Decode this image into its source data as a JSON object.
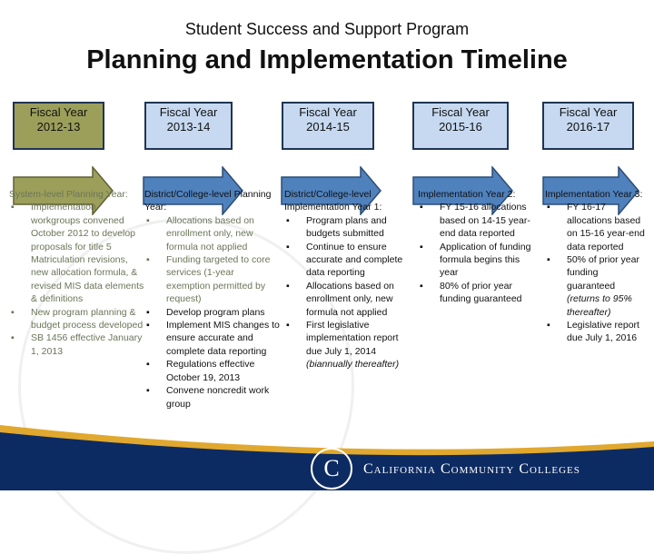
{
  "header": {
    "subtitle": "Student Success and Support Program",
    "title": "Planning and Implementation Timeline"
  },
  "colors": {
    "current_year": "#9c9f5a",
    "future_year": "#c6d9f1",
    "arrow_blue": "#4f81bd",
    "navy": "#0d2b63",
    "gold": "#e0a82e"
  },
  "years": [
    {
      "label": "Fiscal Year",
      "year": "2012-13"
    },
    {
      "label": "Fiscal Year",
      "year": "2013-14"
    },
    {
      "label": "Fiscal Year",
      "year": "2014-15"
    },
    {
      "label": "Fiscal Year",
      "year": "2015-16"
    },
    {
      "label": "Fiscal Year",
      "year": "2016-17"
    }
  ],
  "columns": [
    {
      "heading": "System-level Planning Year:",
      "items": [
        "Implementation workgroups convened October 2012 to develop proposals for title 5 Matriculation revisions, new allocation formula, & revised MIS data elements & definitions",
        "New program planning & budget process developed",
        "SB 1456 effective January 1, 2013"
      ]
    },
    {
      "heading": "District/College-level Planning Year:",
      "items": [
        "Allocations based on enrollment only, new formula not applied",
        "Funding targeted to core services (1-year exemption permitted by request)",
        "Develop program plans",
        "Implement MIS changes to ensure accurate and complete data reporting",
        "Regulations effective October 19, 2013",
        "Convene noncredit work group"
      ]
    },
    {
      "heading": "District/College-level Implementation Year 1:",
      "items": [
        "Program plans and budgets submitted",
        "Continue to ensure accurate and complete data reporting",
        "Allocations based on enrollment only, new formula not applied",
        "First legislative implementation report due July 1, 2014"
      ],
      "note": "(biannually thereafter)"
    },
    {
      "heading": "Implementation Year 2:",
      "items": [
        "FY 15-16 allocations based on 14-15 year-end data reported",
        "Application of funding formula begins this year",
        "80% of prior year funding guaranteed"
      ]
    },
    {
      "heading": "Implementation Year 3:",
      "items": [
        "FY 16-17 allocations based on 15-16 year-end data reported",
        "50% of prior year funding guaranteed",
        "Legislative report due July 1, 2016"
      ],
      "note": "(returns to 95% thereafter)"
    }
  ],
  "footer": {
    "brand": "California Community Colleges",
    "seal_letter": "C"
  }
}
